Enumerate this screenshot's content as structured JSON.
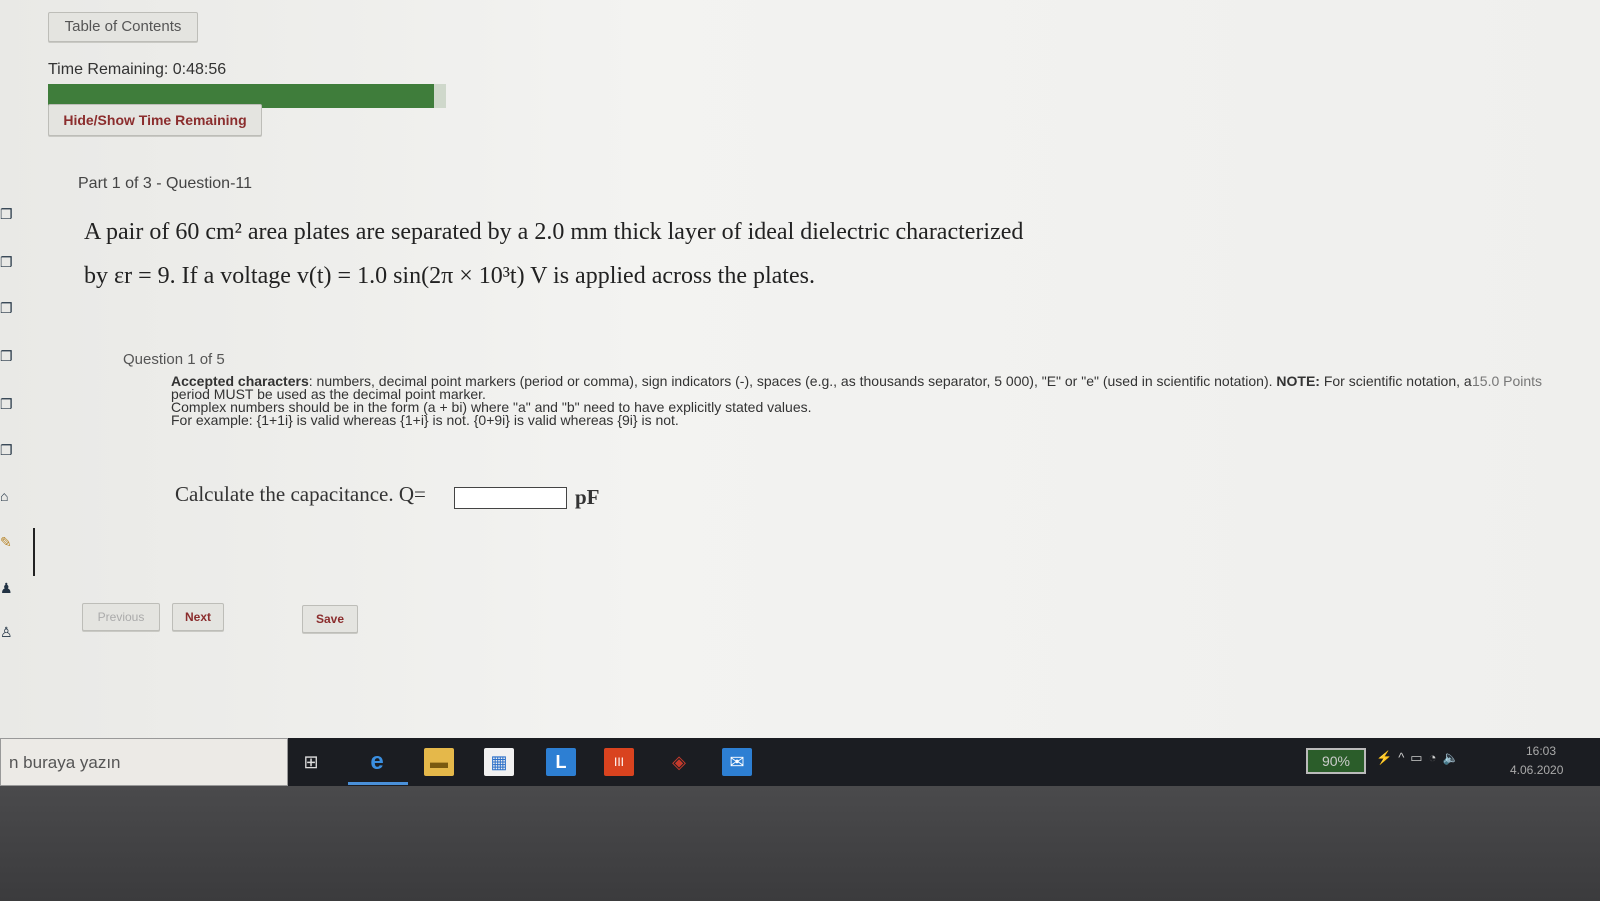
{
  "header": {
    "toc_label": "Table of Contents",
    "time_remaining": "Time Remaining: 0:48:56",
    "time_progress_fraction": 0.97,
    "hide_show_label": "Hide/Show Time Remaining"
  },
  "question": {
    "part_label": "Part 1 of 3 - Question-11",
    "problem_line1": "A pair of 60 cm² area plates are separated by a 2.0 mm thick layer of ideal dielectric characterized",
    "problem_line2": "by εr = 9. If a voltage v(t) = 1.0 sin(2π × 10³t) V  is applied across the plates.",
    "sub_label": "Question 1 of 5",
    "points": "15.0 Points",
    "instructions": {
      "accepted_bold": "Accepted characters",
      "accepted_text": ": numbers, decimal point markers (period or comma), sign indicators (-), spaces (e.g., as thousands separator, 5 000), \"E\" or \"e\" (used in scientific notation).",
      "note_bold": "NOTE:",
      "note_text": "For scientific notation, a period MUST be used as the decimal point marker.",
      "complex_text": "Complex numbers should be in the form (a + bi) where \"a\" and \"b\" need to have explicitly stated values.",
      "example_text": "For example: {1+1i} is valid whereas {1+i} is not. {0+9i} is valid whereas {9i} is not."
    },
    "prompt": "Calculate the capacitance. Q=",
    "answer_value": "",
    "unit": "pF"
  },
  "nav": {
    "previous_label": "Previous",
    "next_label": "Next",
    "save_label": "Save"
  },
  "taskbar": {
    "search_placeholder": "n buraya yazın",
    "battery_label": "90%",
    "clock_time": "16:03",
    "clock_date": "4.06.2020",
    "accent_color": "#4a90d9"
  }
}
